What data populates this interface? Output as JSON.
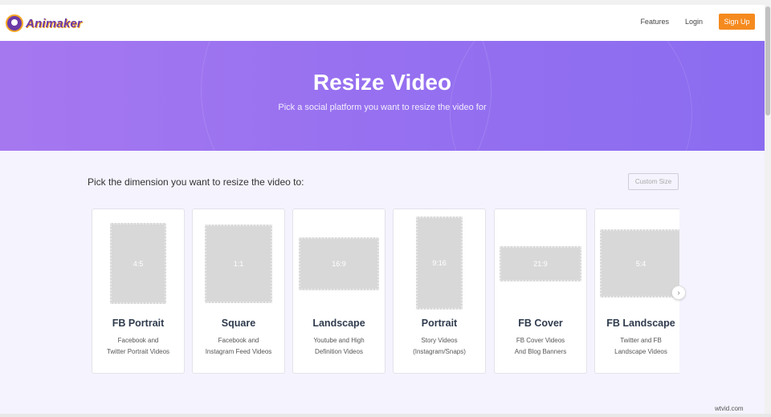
{
  "brand": {
    "name": "Animaker"
  },
  "nav": {
    "features": "Features",
    "login": "Login",
    "signup": "Sign Up"
  },
  "hero": {
    "title": "Resize Video",
    "subtitle": "Pick a social platform you want to resize the video for",
    "gradient_colors": [
      "#a678f0",
      "#8b6cf0"
    ]
  },
  "main": {
    "pick_label": "Pick the dimension you want to resize the video to:",
    "custom_size": "Custom Size"
  },
  "cards": [
    {
      "ratio": "4:5",
      "title": "FB Portrait",
      "desc1": "Facebook and",
      "desc2": "Twitter Portrait Videos"
    },
    {
      "ratio": "1:1",
      "title": "Square",
      "desc1": "Facebook and",
      "desc2": "Instagram Feed Videos"
    },
    {
      "ratio": "16:9",
      "title": "Landscape",
      "desc1": "Youtube and High",
      "desc2": "Definition Videos"
    },
    {
      "ratio": "9:16",
      "title": "Portrait",
      "desc1": "Story Videos",
      "desc2": "(Instagram/Snaps)"
    },
    {
      "ratio": "21:9",
      "title": "FB Cover",
      "desc1": "FB Cover Videos",
      "desc2": "And Blog Banners"
    },
    {
      "ratio": "5:4",
      "title": "FB Landscape",
      "desc1": "Twitter and FB",
      "desc2": "Landscape Videos"
    }
  ],
  "icons": {
    "carousel_next": "chevron-right-icon"
  },
  "colors": {
    "accent": "#f58a1f",
    "brand": "#6c3aa6",
    "background": "#f5f3fd"
  },
  "watermark": "wtvid.com"
}
